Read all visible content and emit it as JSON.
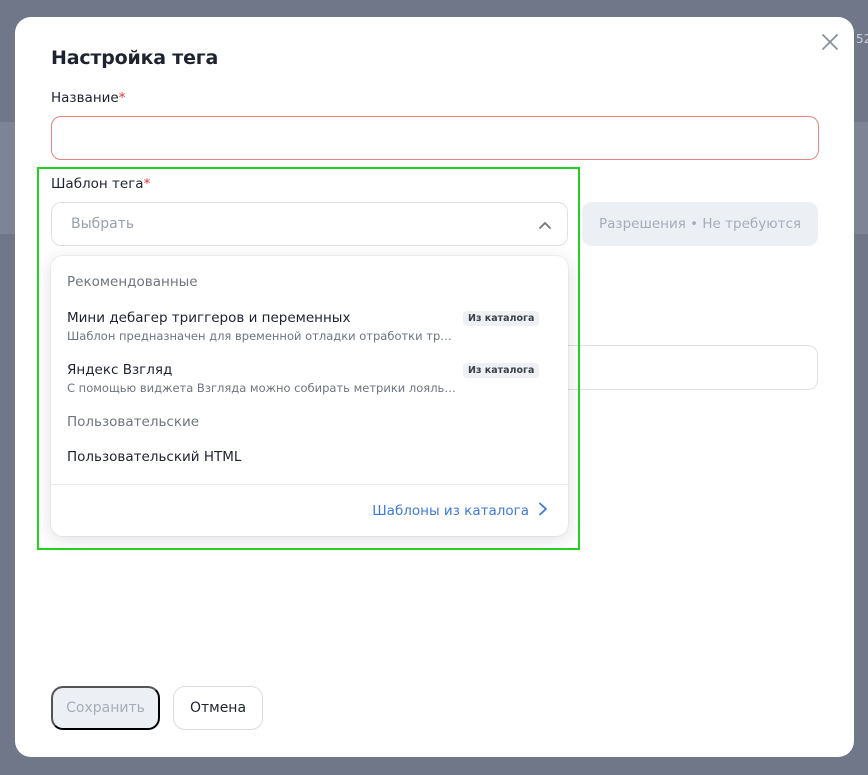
{
  "backdrop": {
    "partial_text": "52"
  },
  "modal": {
    "title": "Настройка тега",
    "name_field": {
      "label": "Название",
      "required_mark": "*",
      "value": "",
      "placeholder": ""
    },
    "template_field": {
      "label": "Шаблон тега",
      "required_mark": "*",
      "placeholder": "Выбрать",
      "expanded": true
    },
    "permissions_badge": "Разрешения • Не требуются",
    "dropdown": {
      "groups": [
        {
          "label": "Рекомендованные",
          "options": [
            {
              "title": "Мини дебагер триггеров и переменных",
              "description": "Шаблон предназначен для временной отладки отработки триггеро...",
              "tag": "Из каталога"
            },
            {
              "title": "Яндекс Взгляд",
              "description": "С помощью виджета Взгляда можно собирать метрики лояльности...",
              "tag": "Из каталога"
            }
          ]
        },
        {
          "label": "Пользовательские",
          "options": [
            {
              "title": "Пользовательский HTML",
              "description": "",
              "tag": ""
            }
          ]
        }
      ],
      "catalog_link": "Шаблоны из каталога"
    },
    "buttons": {
      "save": "Сохранить",
      "cancel": "Отмена"
    }
  },
  "colors": {
    "highlight": "#22d122",
    "link": "#3d7ad8",
    "required": "#e0312f",
    "error_border": "#e5877f"
  }
}
